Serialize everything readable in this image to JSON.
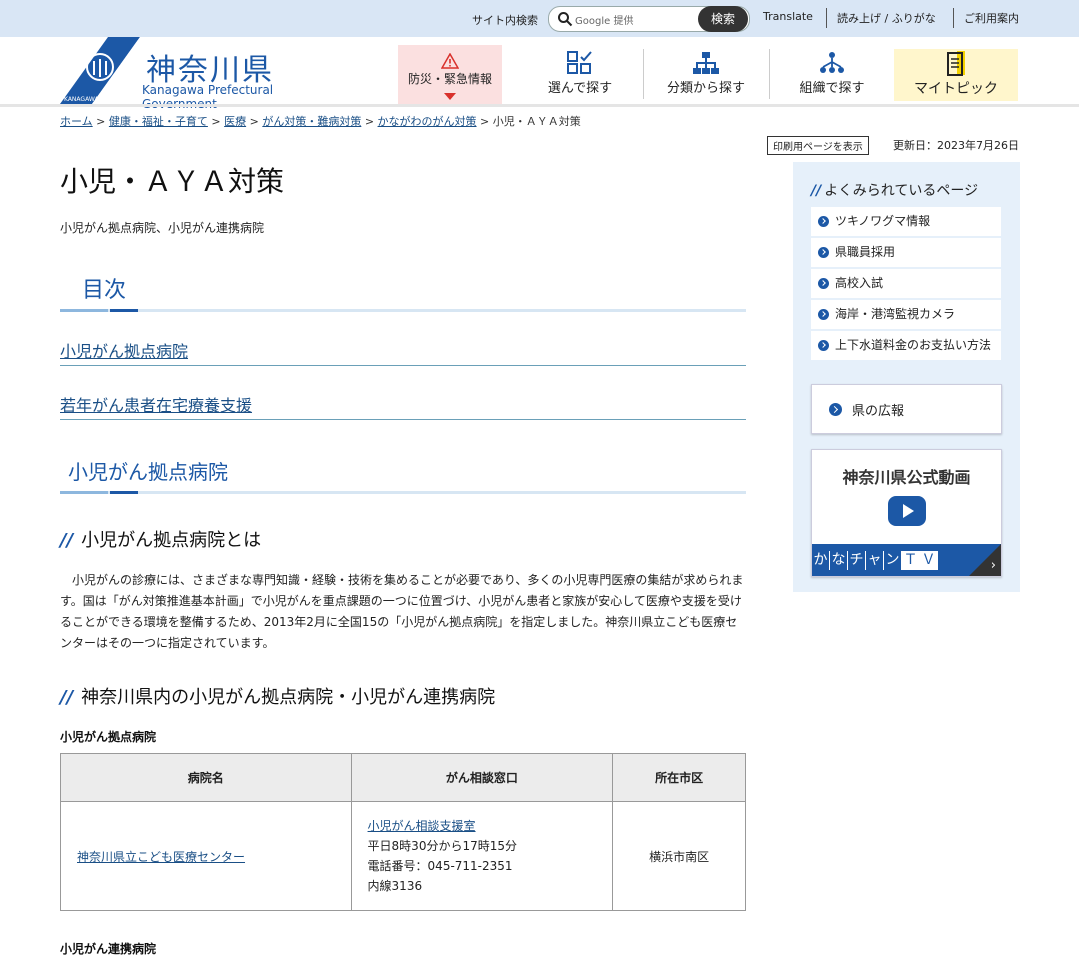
{
  "topbar": {
    "search_label": "サイト内検索",
    "search_placeholder": "Google 提供",
    "search_button": "検索",
    "links": [
      "Translate",
      "読み上げ / ふりがな",
      "ご利用案内"
    ]
  },
  "header": {
    "logo_name": "神奈川県",
    "logo_english": "Kanagawa Prefectural Government",
    "logo_mark_text": "KANAGAWA",
    "disaster": "防災・緊急情報",
    "nav": [
      "選んで探す",
      "分類から探す",
      "組織で探す",
      "マイトピック"
    ]
  },
  "breadcrumb": {
    "items": [
      "ホーム",
      "健康・福祉・子育て",
      "医療",
      "がん対策・難病対策",
      "かながわのがん対策"
    ],
    "current": "小児・ＡＹＡ対策"
  },
  "print_button": "印刷用ページを表示",
  "updated": "更新日：2023年7月26日",
  "main": {
    "title": "小児・ＡＹＡ対策",
    "subtitle": "小児がん拠点病院、小児がん連携病院",
    "toc_heading": "目次",
    "toc": [
      "小児がん拠点病院",
      "若年がん患者在宅療養支援"
    ],
    "section_heading": "小児がん拠点病院",
    "sub1": "小児がん拠点病院とは",
    "paragraph": "小児がんの診療には、さまざまな専門知識・経験・技術を集めることが必要であり、多くの小児専門医療の集結が求められます。国は「がん対策推進基本計画」で小児がんを重点課題の一つに位置づけ、小児がん患者と家族が安心して医療や支援を受けることができる環境を整備するため、2013年2月に全国15の「小児がん拠点病院」を指定しました。神奈川県立こども医療センターはその一つに指定されています。",
    "sub2": "神奈川県内の小児がん拠点病院・小児がん連携病院",
    "table_caption": "小児がん拠点病院",
    "table_headers": [
      "病院名",
      "がん相談窓口",
      "所在市区"
    ],
    "table_row": {
      "hospital": "神奈川県立こども医療センター",
      "consult_link": "小児がん相談支援室",
      "consult_hours": "平日8時30分から17時15分",
      "consult_phone": "電話番号：045-711-2351",
      "consult_ext": "内線3136",
      "city": "横浜市南区"
    },
    "caption2": "小児がん連携病院"
  },
  "sidebar": {
    "heading": "よくみられているページ",
    "items": [
      "ツキノワグマ情報",
      "県職員採用",
      "高校入試",
      "海岸・港湾監視カメラ",
      "上下水道料金のお支払い方法"
    ],
    "pr": "県の広報",
    "video_title": "神奈川県公式動画",
    "video_band": [
      "か",
      "な",
      "チ",
      "ャ",
      "ン",
      "Ｔ",
      "Ｖ"
    ]
  },
  "colors": {
    "brand": "#1c58a6",
    "topbar": "#d9e6f5",
    "sidebar_bg": "#e6f0fa"
  }
}
